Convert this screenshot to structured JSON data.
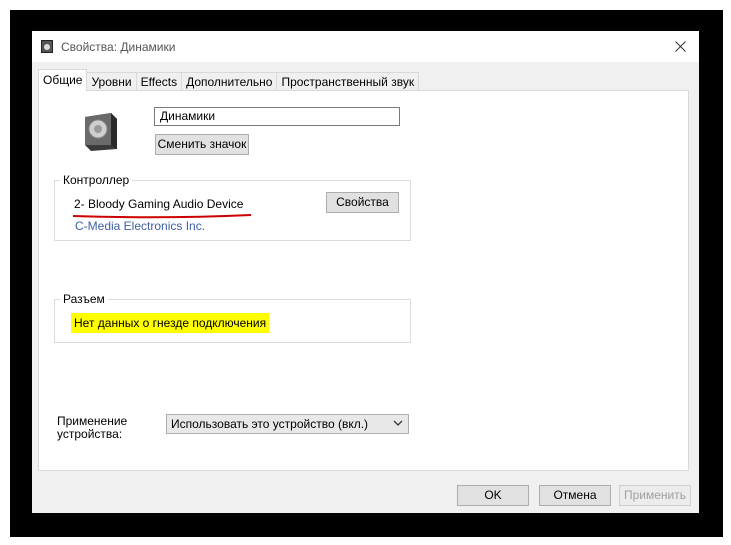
{
  "window": {
    "title": "Свойства: Динамики"
  },
  "tabs": [
    {
      "label": "Общие",
      "active": true
    },
    {
      "label": "Уровни"
    },
    {
      "label": "Effects"
    },
    {
      "label": "Дополнительно"
    },
    {
      "label": "Пространственный звук"
    }
  ],
  "general": {
    "device_name_value": "Динамики",
    "change_icon_label": "Сменить значок",
    "controller": {
      "label": "Контроллер",
      "device": "2- Bloody Gaming Audio Device",
      "vendor": "C-Media Electronics Inc.",
      "properties_label": "Свойства"
    },
    "jack": {
      "label": "Разъем",
      "info": "Нет данных о гнезде подключения"
    },
    "usage": {
      "label_line1": "Применение",
      "label_line2": "устройства:",
      "selected": "Использовать это устройство (вкл.)"
    }
  },
  "footer": {
    "ok_label": "OK",
    "cancel_label": "Отмена",
    "apply_label": "Применить"
  },
  "colors": {
    "vendor_link": "#3f5ea8",
    "highlight": "#ffff00",
    "underline": "#cc0000"
  }
}
